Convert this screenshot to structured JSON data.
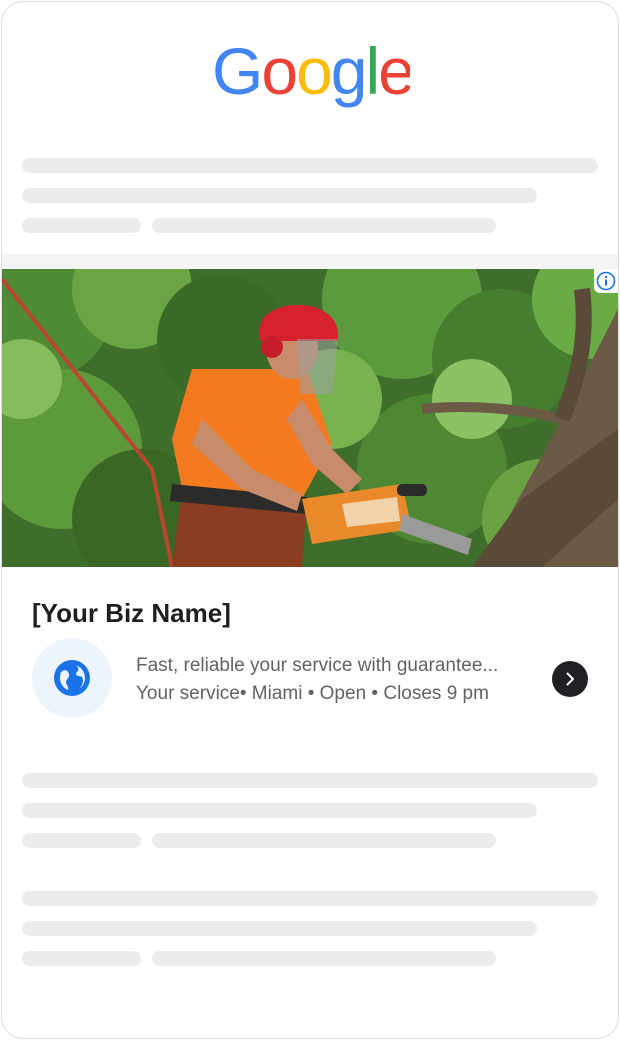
{
  "logo": {
    "letters": [
      "G",
      "o",
      "o",
      "g",
      "l",
      "e"
    ],
    "colors": [
      "#4285F4",
      "#EA4335",
      "#FBBC05",
      "#4285F4",
      "#34A853",
      "#EA4335"
    ]
  },
  "ad": {
    "business_name": "[Your Biz Name]",
    "description": "Fast, reliable your service with guarantee...",
    "meta": "Your service• Miami • Open • Closes 9 pm",
    "icons": {
      "info": "info-icon",
      "business": "globe-icon",
      "action": "chevron-right-icon"
    },
    "colors": {
      "accent": "#1A73E8",
      "button": "#202124"
    }
  }
}
